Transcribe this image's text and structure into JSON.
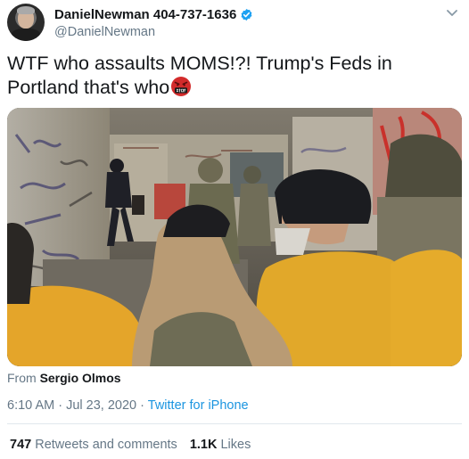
{
  "author": {
    "display_name": "DanielNewman 404-737-1636",
    "handle": "@DanielNewman"
  },
  "icons": {
    "verified": "verified-badge-icon",
    "menu": "chevron-down-icon",
    "emoji": "angry-swearing-face-emoji"
  },
  "colors": {
    "link": "#1b95e0",
    "secondary_text": "#657786",
    "verified": "#1da1f2"
  },
  "tweet": {
    "text": "WTF who assaults MOMS!?! Trump's Feds in Portland that's who"
  },
  "media": {
    "type": "video"
  },
  "source": {
    "prefix": "From",
    "name": "Sergio Olmos"
  },
  "meta": {
    "time": "6:10 AM",
    "date": "Jul 23, 2020",
    "client": "Twitter for iPhone",
    "separator": "·"
  },
  "stats": {
    "retweets_count": "747",
    "retweets_label": "Retweets and comments",
    "likes_count": "1.1K",
    "likes_label": "Likes"
  }
}
